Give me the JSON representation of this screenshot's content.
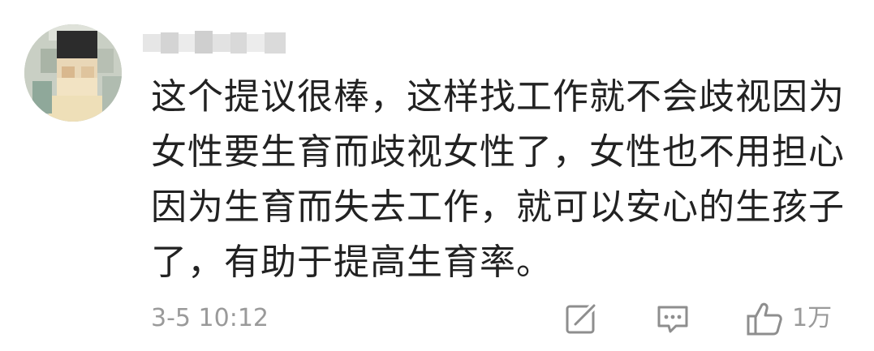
{
  "comment": {
    "username": "",
    "text": "这个提议很棒，这样找工作就不会歧视因为女性要生育而歧视女性了，女性也不用担心因为生育而失去工作，就可以安心的生孩子了，有助于提高生育率。",
    "timestamp": "3-5 10:12",
    "like_count": "1万"
  },
  "icons": {
    "edit": "edit-icon",
    "reply": "comment-icon",
    "like": "thumbs-up-icon"
  },
  "colors": {
    "text": "#222222",
    "meta": "#9a9a9a",
    "icon": "#8e8e8e"
  }
}
